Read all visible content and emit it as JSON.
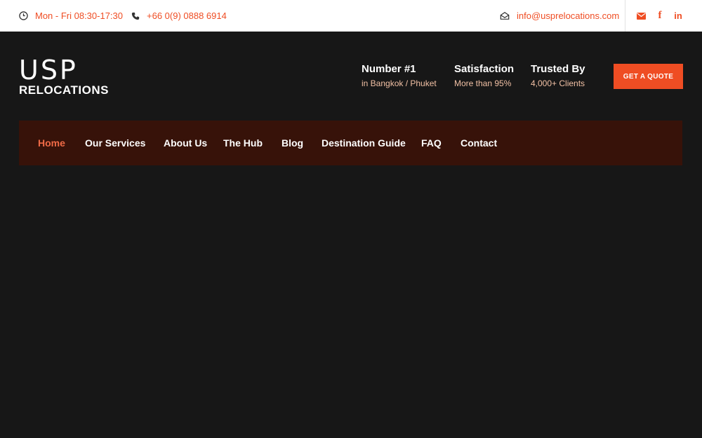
{
  "topbar": {
    "hours": "Mon - Fri 08:30-17:30",
    "phone": "+66 0(9) 0888 6914",
    "email": "info@usprelocations.com",
    "social": {
      "mail": "✉",
      "facebook": "f",
      "linkedin": "in"
    }
  },
  "logo": {
    "line1": "USP",
    "line2": "RELOCATIONS"
  },
  "stats": [
    {
      "title": "Number #1",
      "sub": "in Bangkok / Phuket"
    },
    {
      "title": "Satisfaction",
      "sub": "More than 95%"
    },
    {
      "title": "Trusted By",
      "sub": "4,000+ Clients"
    }
  ],
  "cta": {
    "label": "GET A QUOTE"
  },
  "nav": {
    "items": [
      {
        "label": "Home",
        "active": true
      },
      {
        "label": "Our Services"
      },
      {
        "label": "About Us"
      },
      {
        "label": "The Hub"
      },
      {
        "label": "Blog"
      },
      {
        "label": "Destination Guide"
      },
      {
        "label": "FAQ"
      },
      {
        "label": "Contact"
      }
    ]
  },
  "colors": {
    "accent": "#ef4d23",
    "background": "#171717",
    "nav_bg": "#371209",
    "topbar_bg": "#ffffff"
  },
  "icons": [
    "clock-icon",
    "phone-icon",
    "envelope-open-icon",
    "mail-icon",
    "facebook-icon",
    "linkedin-icon"
  ]
}
